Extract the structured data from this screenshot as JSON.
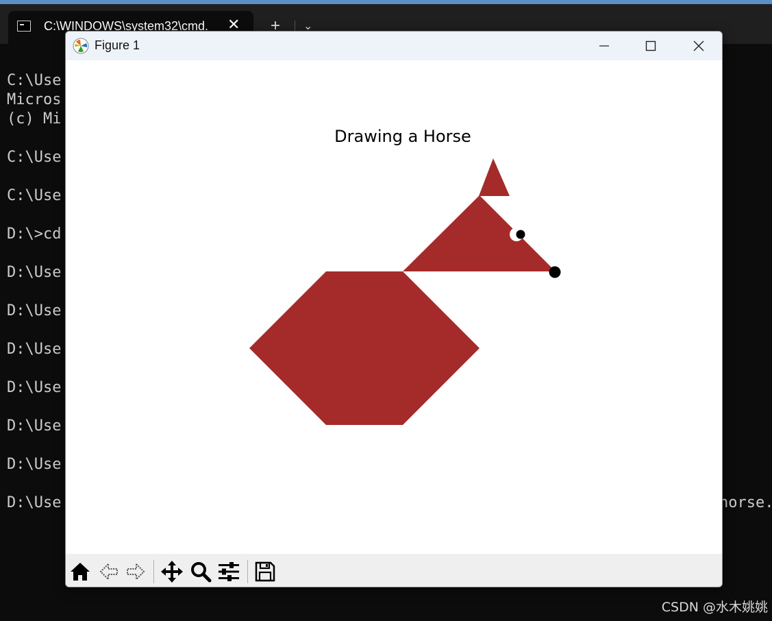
{
  "terminal": {
    "tab_title": "C:\\WINDOWS\\system32\\cmd.",
    "lines": [
      "C:\\Use",
      "Micros",
      "(c) Mi",
      "",
      "C:\\Use",
      "",
      "C:\\Use",
      "",
      "D:\\>cd",
      "",
      "D:\\Use",
      "",
      "D:\\Use",
      "",
      "D:\\Use",
      "",
      "D:\\Use",
      "",
      "D:\\Use",
      "",
      "D:\\Use",
      "",
      "D:\\Use"
    ],
    "right_text": "horse."
  },
  "figure": {
    "window_title": "Figure 1",
    "plot_title": "Drawing a Horse",
    "colors": {
      "horse": "#a52a2a",
      "eye": "#000000",
      "background": "#ffffff"
    }
  },
  "toolbar": {
    "buttons": [
      "home-icon",
      "back-icon",
      "forward-icon",
      "pan-icon",
      "zoom-icon",
      "configure-subplots-icon",
      "save-icon"
    ]
  },
  "watermark": "CSDN @水木姚姚"
}
